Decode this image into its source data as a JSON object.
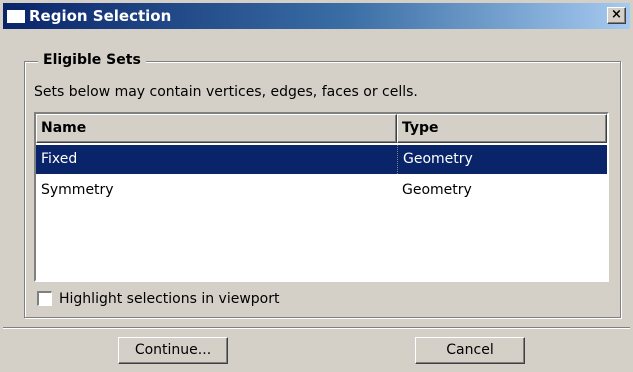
{
  "window": {
    "title": "Region Selection",
    "close_glyph": "×"
  },
  "group": {
    "legend": "Eligible Sets",
    "description": "Sets below may contain vertices, edges, faces or cells."
  },
  "table": {
    "columns": [
      "Name",
      "Type"
    ],
    "rows": [
      {
        "name": "Fixed",
        "type": "Geometry",
        "selected": true
      },
      {
        "name": "Symmetry",
        "type": "Geometry",
        "selected": false
      }
    ]
  },
  "options": {
    "highlight_label": "Highlight selections in viewport",
    "highlight_checked": false
  },
  "buttons": {
    "continue_label": "Continue...",
    "cancel_label": "Cancel"
  },
  "colors": {
    "title_start": "#0a246a",
    "title_end": "#a6caf0",
    "selection": "#0a246a",
    "face": "#d4d0c8"
  }
}
